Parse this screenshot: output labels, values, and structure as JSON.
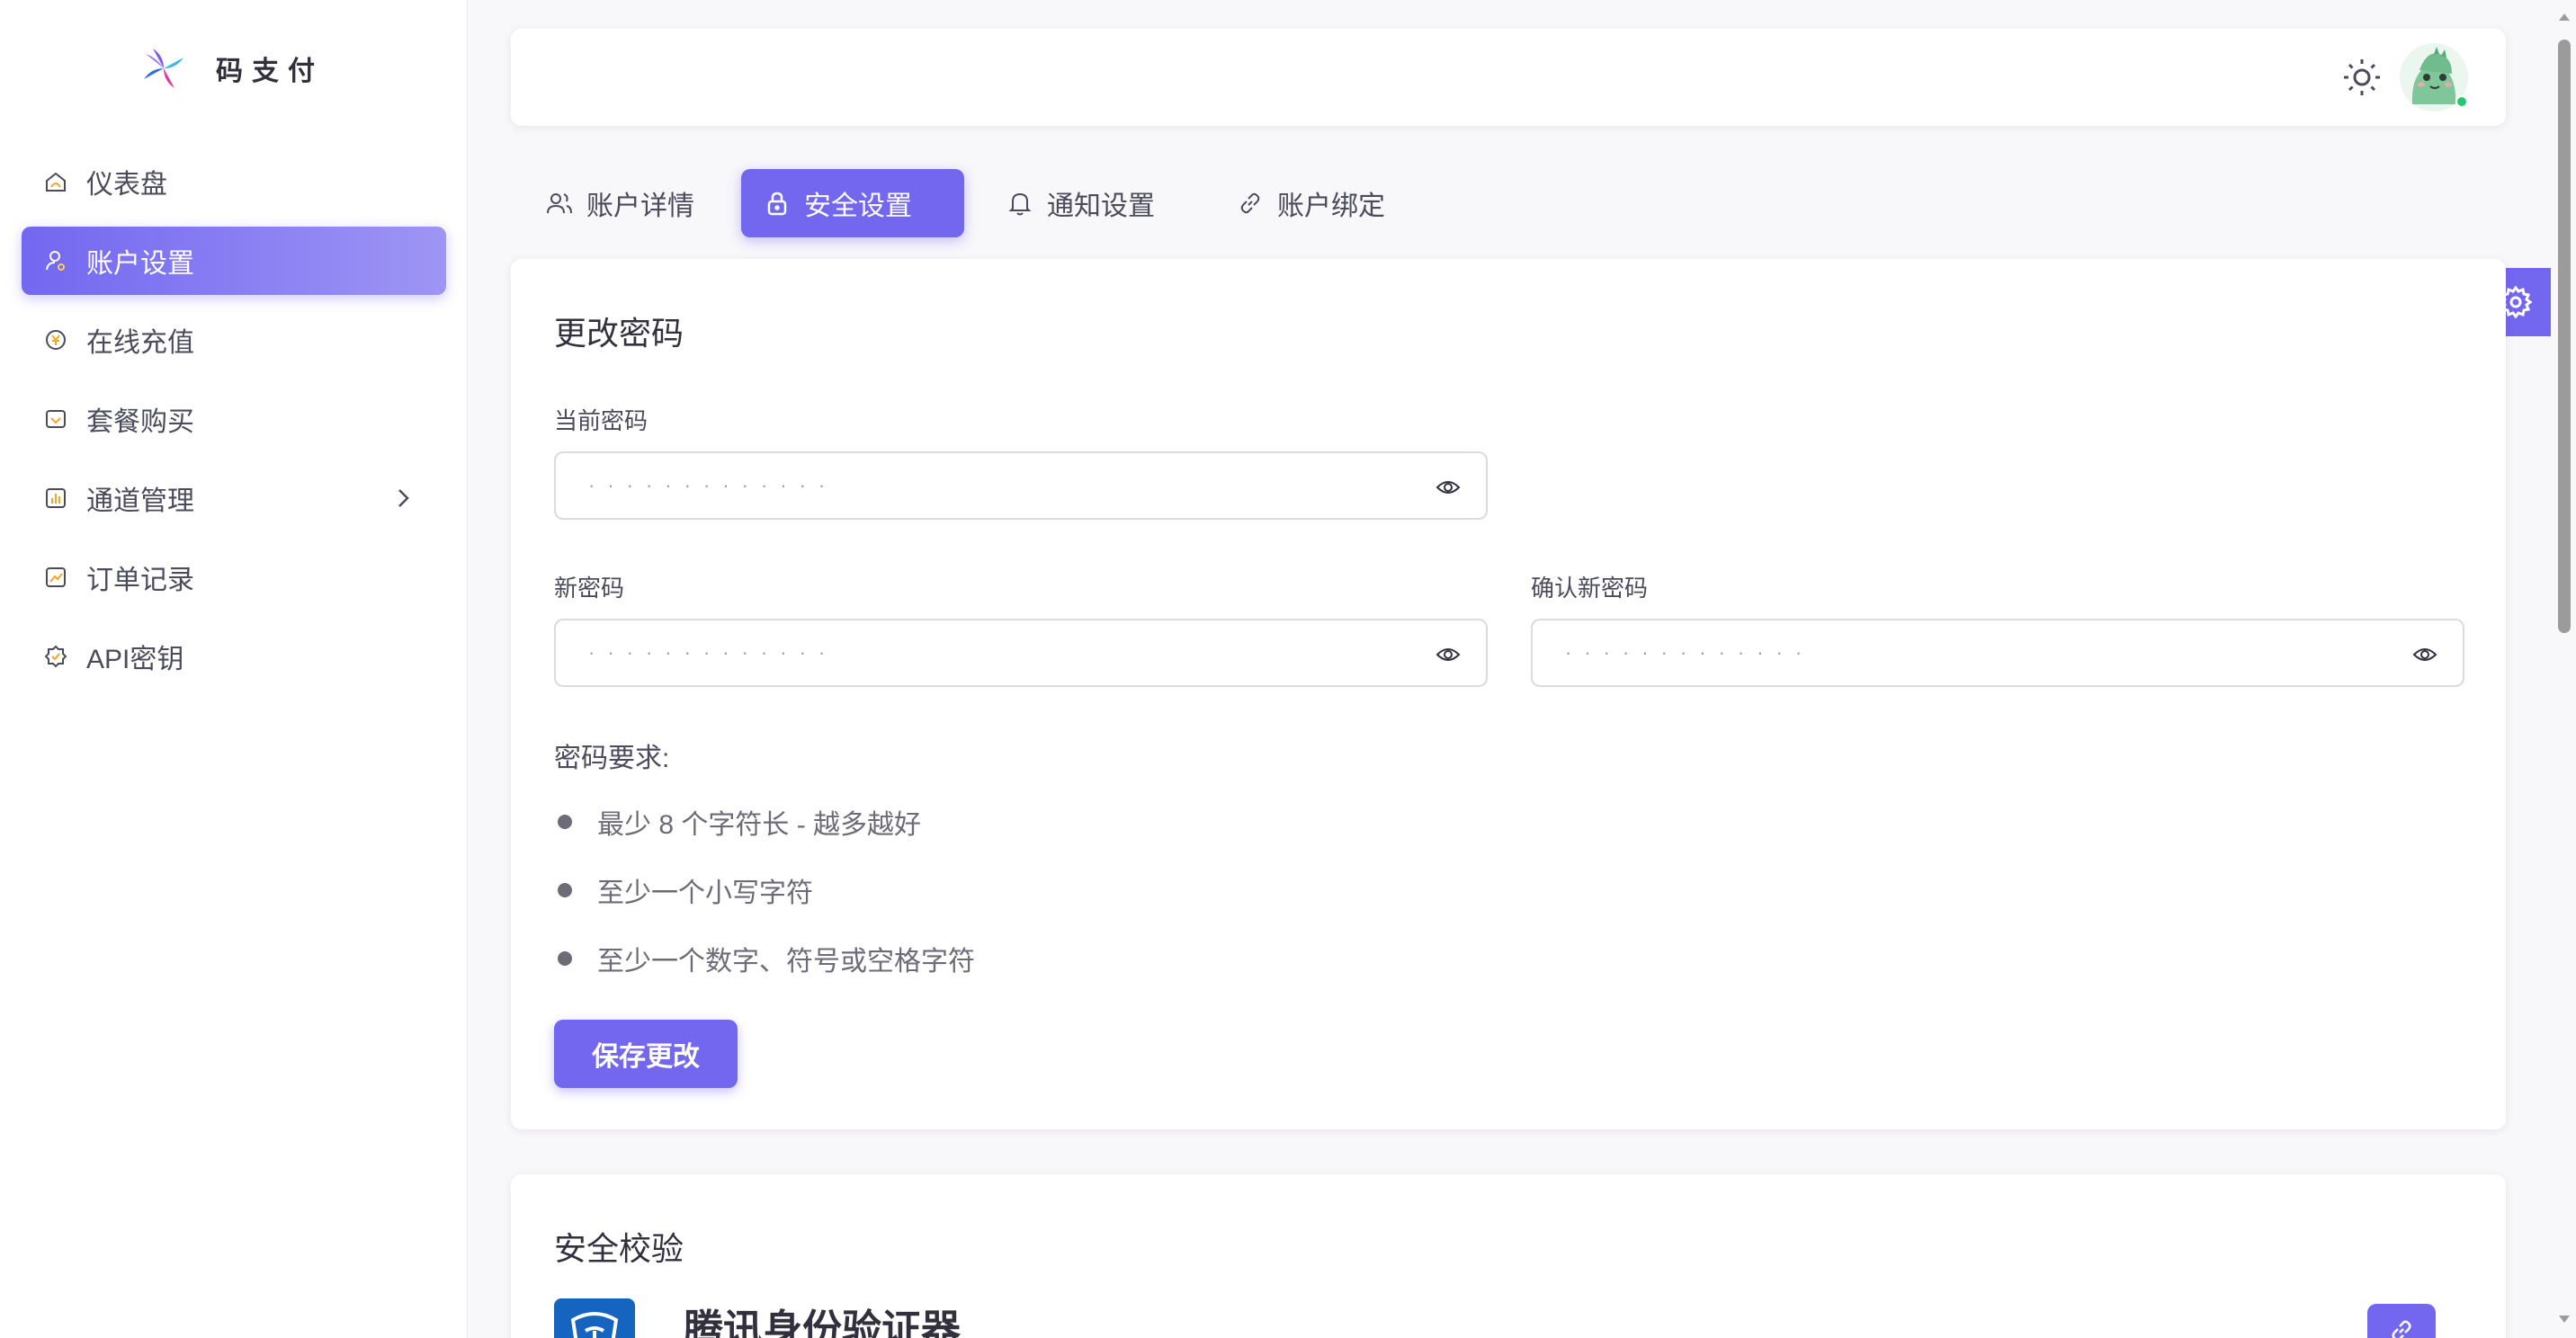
{
  "brand": {
    "name": "码支付"
  },
  "sidebar": {
    "items": [
      {
        "label": "仪表盘",
        "icon": "dashboard-icon"
      },
      {
        "label": "账户设置",
        "icon": "user-settings-icon",
        "active": true
      },
      {
        "label": "在线充值",
        "icon": "coin-icon"
      },
      {
        "label": "套餐购买",
        "icon": "package-icon"
      },
      {
        "label": "通道管理",
        "icon": "chart-icon",
        "expandable": true
      },
      {
        "label": "订单记录",
        "icon": "trend-icon"
      },
      {
        "label": "API密钥",
        "icon": "key-badge-icon"
      }
    ]
  },
  "tabs": [
    {
      "label": "账户详情",
      "icon": "users-icon"
    },
    {
      "label": "安全设置",
      "icon": "lock-icon",
      "active": true
    },
    {
      "label": "通知设置",
      "icon": "bell-icon"
    },
    {
      "label": "账户绑定",
      "icon": "link-icon"
    }
  ],
  "password_card": {
    "title": "更改密码",
    "current_label": "当前密码",
    "current_value": "·············",
    "new_label": "新密码",
    "new_value": "·············",
    "confirm_label": "确认新密码",
    "confirm_value": "·············",
    "requirements_title": "密码要求:",
    "requirements": [
      "最少 8 个字符长 - 越多越好",
      "至少一个小写字符",
      "至少一个数字、符号或空格字符"
    ],
    "save_label": "保存更改"
  },
  "security_card": {
    "title": "安全校验",
    "app_name": "腾讯身份验证器"
  },
  "colors": {
    "accent": "#7367f0",
    "online": "#28c76f"
  }
}
